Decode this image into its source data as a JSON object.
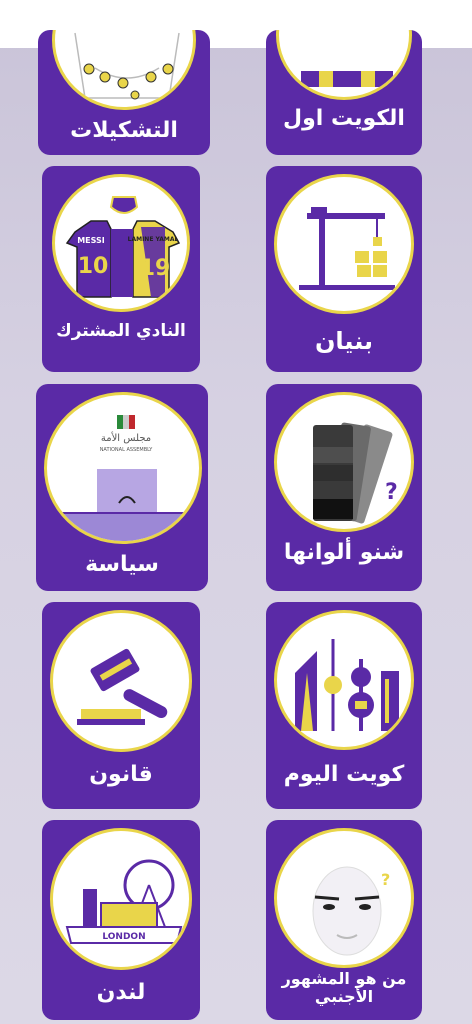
{
  "categories": [
    {
      "id": "formations",
      "label": "التشكيلات",
      "icon": "pitch-icon"
    },
    {
      "id": "kuwait-first",
      "label": "الكويت اول",
      "icon": "kuwait-flag-icon"
    },
    {
      "id": "shared-club",
      "label": "النادي المشترك",
      "icon": "jersey-icon",
      "jersey_left_name": "MESSI",
      "jersey_left_number": "10",
      "jersey_right_name": "LAMINE YAMAL",
      "jersey_right_number": "19"
    },
    {
      "id": "building",
      "label": "بنيان",
      "icon": "crane-icon"
    },
    {
      "id": "politics",
      "label": "سياسة",
      "icon": "parliament-icon",
      "caption_ar": "مجلس الأمة",
      "caption_en": "NATIONAL ASSEMBLY"
    },
    {
      "id": "what-colors",
      "label": "شنو ألوانها",
      "icon": "color-swatch-icon"
    },
    {
      "id": "law",
      "label": "قانون",
      "icon": "gavel-icon"
    },
    {
      "id": "kuwait-today",
      "label": "كويت اليوم",
      "icon": "kuwait-towers-icon"
    },
    {
      "id": "london",
      "label": "لندن",
      "icon": "london-icon",
      "caption": "LONDON"
    },
    {
      "id": "foreign-celebrity",
      "label": "من هو المشهور الأجنبي",
      "icon": "celebrity-face-icon"
    }
  ],
  "colors": {
    "card": "#5a2aa6",
    "accent": "#e9d54a",
    "background": "#d6d1e2"
  }
}
